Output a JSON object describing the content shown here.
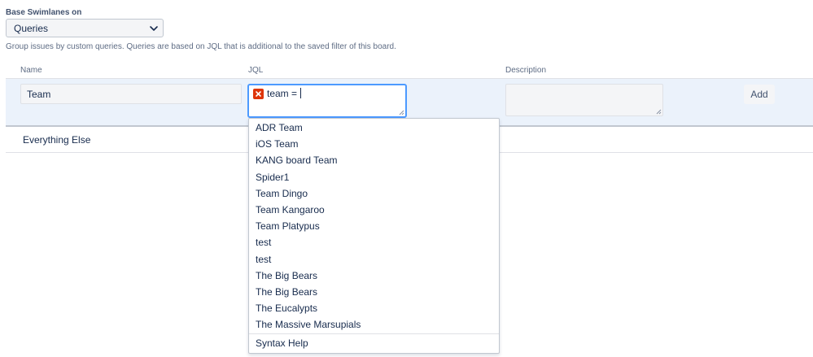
{
  "base": {
    "label": "Base Swimlanes on",
    "selected": "Queries",
    "description": "Group issues by custom queries. Queries are based on JQL that is additional to the saved filter of this board."
  },
  "columns": {
    "name": "Name",
    "jql": "JQL",
    "description": "Description"
  },
  "edit_row": {
    "name_value": "Team",
    "jql_value": "team = ",
    "description_value": "",
    "add_label": "Add"
  },
  "rows": [
    {
      "name": "Everything Else"
    }
  ],
  "dropdown": {
    "items": [
      "ADR Team",
      "iOS Team",
      "KANG board Team",
      "Spider1",
      "Team Dingo",
      "Team Kangaroo",
      "Team Platypus",
      "test",
      "test",
      "The Big Bears",
      "The Big Bears",
      "The Eucalypts",
      "The Massive Marsupials"
    ],
    "help": "Syntax Help"
  },
  "colors": {
    "accent": "#4c9aff",
    "error": "#de350b",
    "row_highlight": "#ebf2fb"
  },
  "icons": {
    "select": "chevron-down-icon",
    "jql_status": "error-icon",
    "textarea": "resize-handle-icon"
  }
}
